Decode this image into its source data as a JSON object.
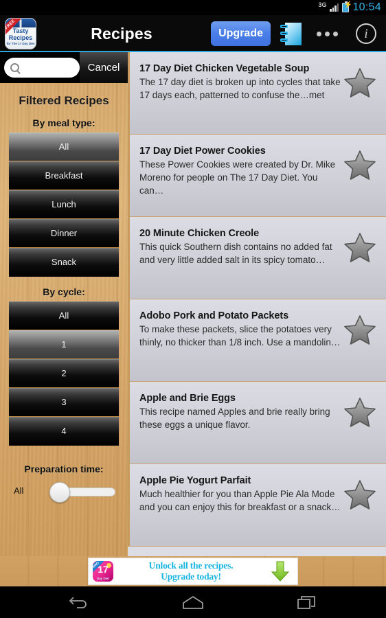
{
  "status_bar": {
    "network": "3G",
    "time": "10:54",
    "signal_icon": "signal-bars-icon",
    "battery_icon": "battery-charging-icon"
  },
  "action_bar": {
    "app_icon": {
      "name": "tasty-recipes-app-icon",
      "ribbon": "FREE",
      "line1": "Tasty",
      "line2": "Recipes",
      "line3": "for The 17 Day Diet"
    },
    "title": "Recipes",
    "upgrade_label": "Upgrade",
    "notes_icon": "notebook-icon",
    "overflow_icon": "more-options-icon",
    "info_icon": "info-icon"
  },
  "sidebar": {
    "search": {
      "value": "",
      "placeholder": "",
      "icon": "search-icon"
    },
    "cancel_label": "Cancel",
    "panel_title": "Filtered Recipes",
    "meal_type": {
      "label": "By meal type:",
      "options": [
        "All",
        "Breakfast",
        "Lunch",
        "Dinner",
        "Snack"
      ],
      "selected": "All"
    },
    "cycle": {
      "label": "By cycle:",
      "options": [
        "All",
        "1",
        "2",
        "3",
        "4"
      ],
      "selected": "1"
    },
    "prep_time": {
      "label": "Preparation time:",
      "value": "All",
      "slider_icon": "slider-knob"
    }
  },
  "recipes": [
    {
      "title": "17 Day Diet Chicken Vegetable Soup",
      "desc": "The 17 day diet is broken up into cycles that take 17 days each, patterned to confuse the…met",
      "favorite_icon": "star-icon"
    },
    {
      "title": "17 Day Diet Power Cookies",
      "desc": "These Power Cookies were created by Dr. Mike Moreno for people on The 17 Day Diet. You can…",
      "favorite_icon": "star-icon"
    },
    {
      "title": "20 Minute Chicken Creole",
      "desc": "This quick Southern dish contains no added fat and very little added salt in its spicy tomato…",
      "favorite_icon": "star-icon"
    },
    {
      "title": "Adobo Pork and Potato Packets",
      "desc": "To make these packets, slice the potatoes very thinly, no thicker than 1/8 inch. Use a mandolin…",
      "favorite_icon": "star-icon"
    },
    {
      "title": "Apple and Brie Eggs",
      "desc": "This recipe named Apples and brie really bring these eggs a unique flavor.",
      "favorite_icon": "star-icon"
    },
    {
      "title": "Apple Pie Yogurt Parfait",
      "desc": "Much healthier for you than Apple Pie Ala Mode and you can enjoy this for breakfast or a snack…",
      "favorite_icon": "star-icon"
    }
  ],
  "ad": {
    "icon": "pro-17-day-diet-icon",
    "icon_badge": "PRO",
    "icon_number": "17",
    "icon_sub": "Day Diet",
    "line1": "Unlock all the recipes.",
    "line2": "Upgrade today!",
    "arrow_icon": "download-arrow-icon"
  },
  "navbar": {
    "back_icon": "back-icon",
    "home_icon": "home-icon",
    "recents_icon": "recents-icon"
  },
  "colors": {
    "accent": "#2aa8dd",
    "upgrade": "#4a7ee8",
    "wood": "#d7a869",
    "list_bg": "#dcdce4",
    "ad_text": "#17b5e0"
  }
}
